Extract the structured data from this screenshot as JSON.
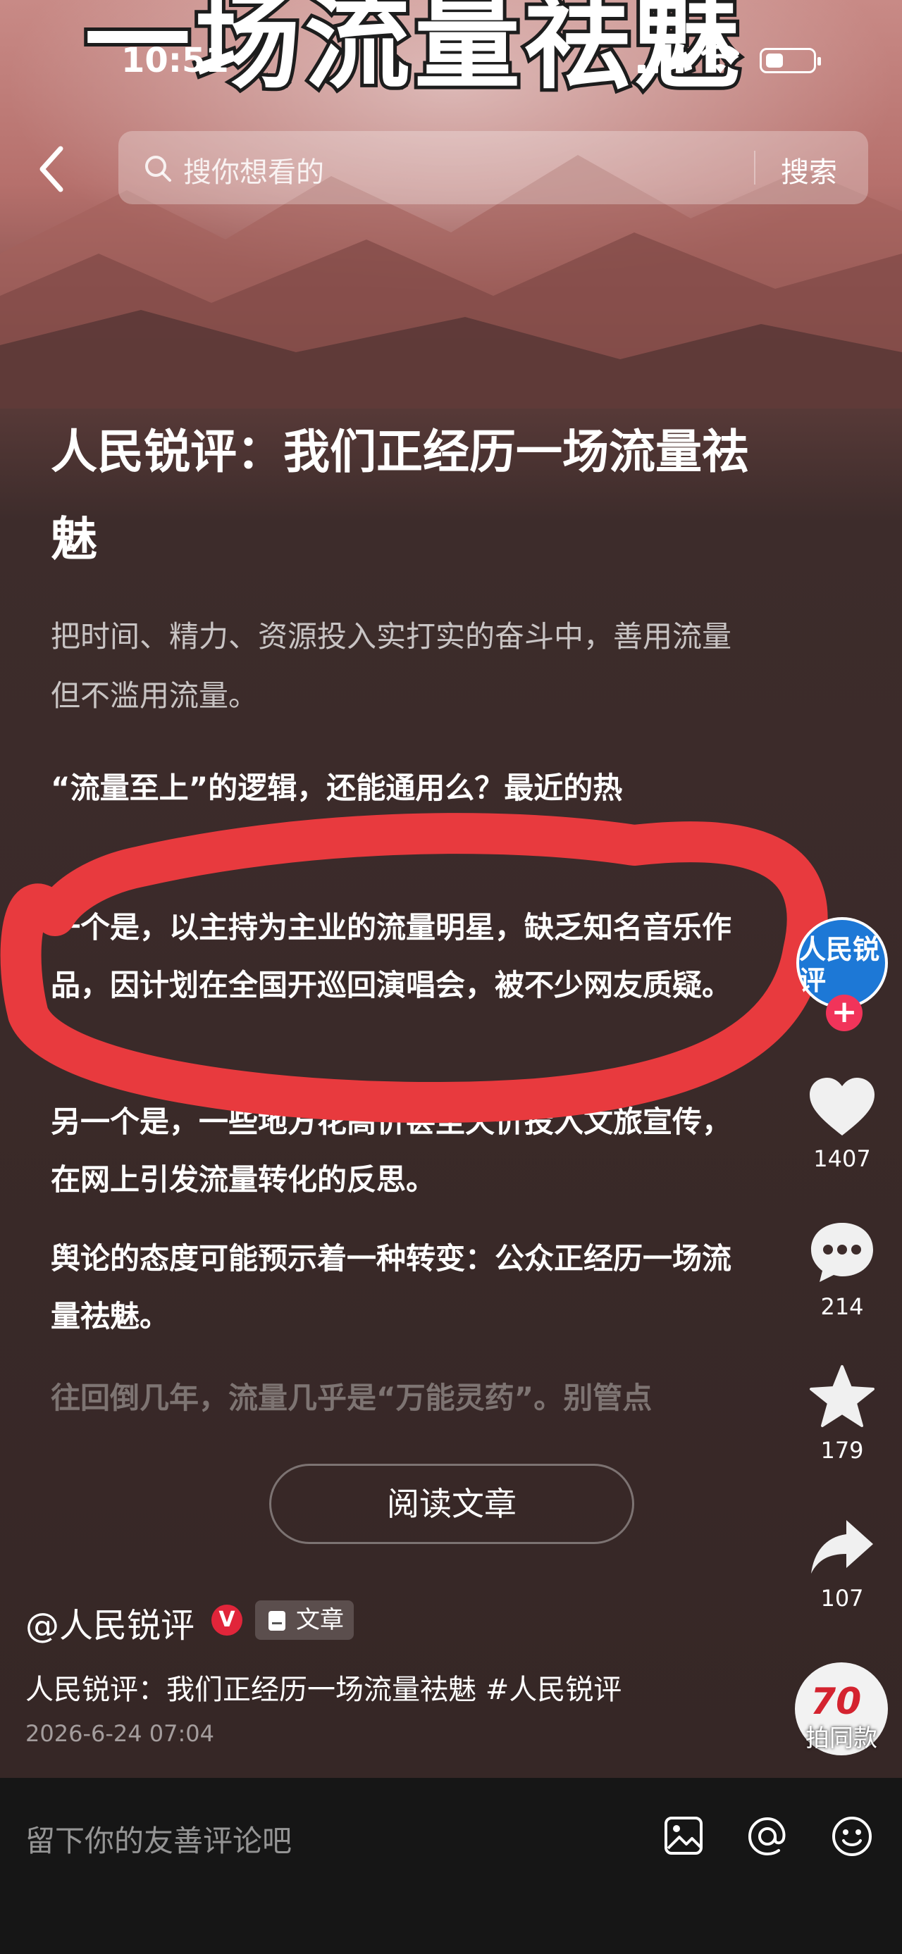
{
  "banner": {
    "text": "一场流量祛魅"
  },
  "status_bar": {
    "time": "10:51"
  },
  "search": {
    "placeholder": "搜你想看的",
    "button": "搜索"
  },
  "article": {
    "title": "人民锐评：我们正经历一场流量祛魅",
    "subtitle": "把时间、精力、资源投入实打实的奋斗中，善用流量但不滥用流量。",
    "paragraphs": [
      "“流量至上”的逻辑，还能通用么？最近的热",
      "一个是，以主持为主业的流量明星，缺乏知名音乐作品，因计划在全国开巡回演唱会，被不少网友质疑。",
      "另一个是，一些地方花高价甚至天价投入文旅宣传，在网上引发流量转化的反思。",
      "舆论的态度可能预示着一种转变：公众正经历一场流量祛魅。",
      "往回倒几年，流量几乎是“万能灵药”。别管点"
    ],
    "read_button": "阅读文章"
  },
  "sidebar": {
    "avatar_text": "人民锐评",
    "follow": "+",
    "likes": "1407",
    "comments": "214",
    "favorites": "179",
    "shares": "107"
  },
  "author": {
    "name": "@人民锐评",
    "verified": "V",
    "tag": "文章",
    "caption": "人民锐评：我们正经历一场流量祛魅 #人民锐评",
    "date": "2026-6-24 07:04"
  },
  "music": {
    "logo": "70",
    "label": "拍同款"
  },
  "comment": {
    "placeholder": "留下你的友善评论吧"
  },
  "colors": {
    "accent_red": "#e83a3e",
    "follow_pink": "#f1345a",
    "avatar_blue": "#1d78d6"
  },
  "icons": [
    "back-icon",
    "search-icon",
    "heart-icon",
    "comment-icon",
    "star-icon",
    "share-icon",
    "image-icon",
    "at-icon",
    "emoji-icon"
  ]
}
